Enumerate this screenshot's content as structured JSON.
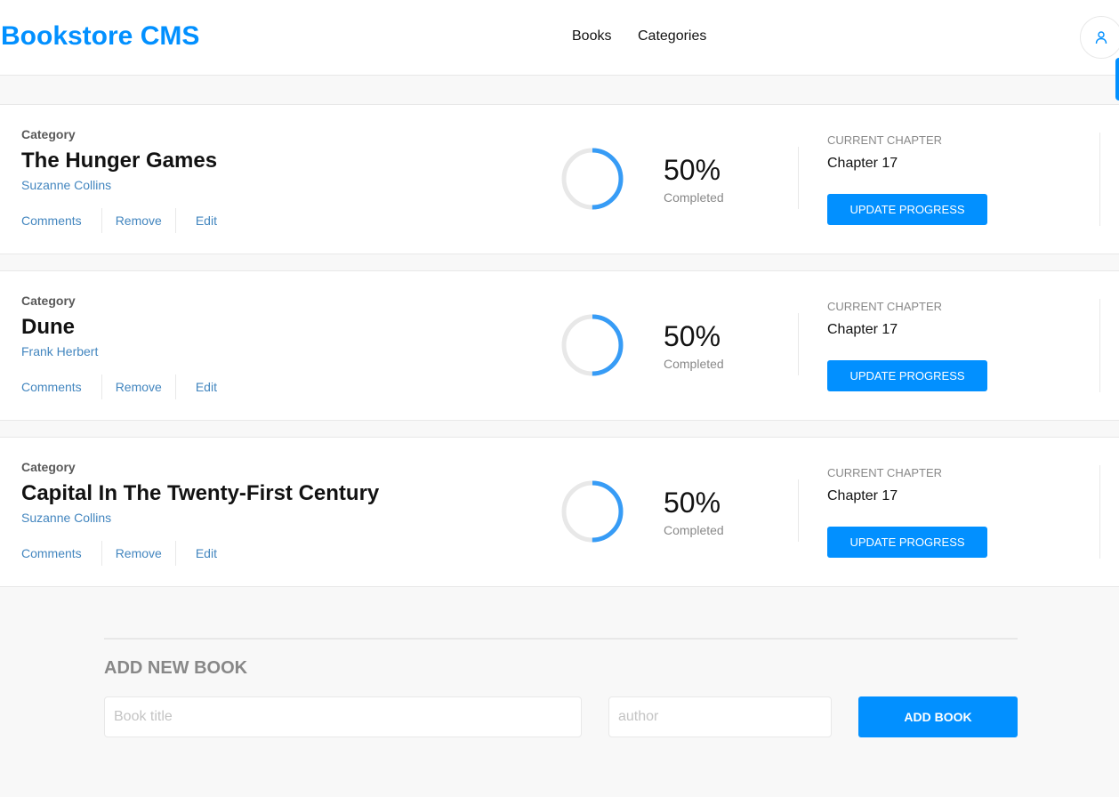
{
  "header": {
    "logo": "Bookstore CMS",
    "nav": [
      "Books",
      "Categories"
    ],
    "user_icon": "user-icon"
  },
  "colors": {
    "accent": "#0290ff",
    "link": "#4386bf",
    "ring_track": "#e8e8e8",
    "ring_fill": "#379cf6"
  },
  "books": [
    {
      "category": "Category",
      "title": "The Hunger Games",
      "author": "Suzanne Collins",
      "actions": [
        "Comments",
        "Remove",
        "Edit"
      ],
      "progress": 0.5,
      "percent_text": "50%",
      "completed_label": "Completed",
      "chapter_label": "CURRENT CHAPTER",
      "chapter": "Chapter 17",
      "update_label": "UPDATE PROGRESS"
    },
    {
      "category": "Category",
      "title": "Dune",
      "author": "Frank Herbert",
      "actions": [
        "Comments",
        "Remove",
        "Edit"
      ],
      "progress": 0.5,
      "percent_text": "50%",
      "completed_label": "Completed",
      "chapter_label": "CURRENT CHAPTER",
      "chapter": "Chapter 17",
      "update_label": "UPDATE PROGRESS"
    },
    {
      "category": "Category",
      "title": "Capital In The Twenty-First Century",
      "author": "Suzanne Collins",
      "actions": [
        "Comments",
        "Remove",
        "Edit"
      ],
      "progress": 0.5,
      "percent_text": "50%",
      "completed_label": "Completed",
      "chapter_label": "CURRENT CHAPTER",
      "chapter": "Chapter 17",
      "update_label": "UPDATE PROGRESS"
    }
  ],
  "add_form": {
    "title": "ADD NEW BOOK",
    "title_placeholder": "Book title",
    "author_placeholder": "author",
    "submit_label": "ADD BOOK"
  }
}
